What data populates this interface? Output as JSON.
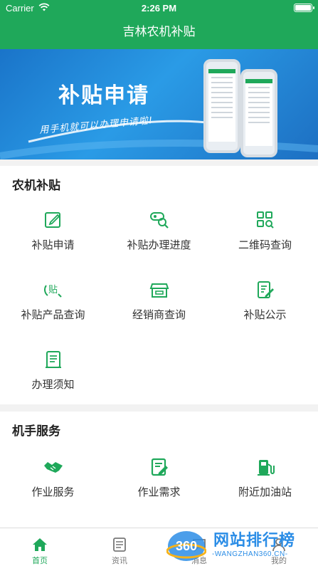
{
  "status_bar": {
    "carrier": "Carrier",
    "time": "2:26 PM"
  },
  "nav": {
    "title": "吉林农机补贴"
  },
  "banner": {
    "title": "补贴申请",
    "slogan": "用手机就可以办理申请啦!"
  },
  "colors": {
    "brand_green": "#1fa85a",
    "banner_blue": "#1f86d6"
  },
  "sections": {
    "subsidy": {
      "title": "农机补贴",
      "items": [
        {
          "label": "补贴申请",
          "icon": "edit-icon"
        },
        {
          "label": "补贴办理进度",
          "icon": "progress-search-icon"
        },
        {
          "label": "二维码查询",
          "icon": "qr-search-icon"
        },
        {
          "label": "补贴产品查询",
          "icon": "subsidy-search-icon"
        },
        {
          "label": "经销商查询",
          "icon": "store-icon"
        },
        {
          "label": "补贴公示",
          "icon": "notice-icon"
        },
        {
          "label": "办理须知",
          "icon": "document-icon"
        }
      ]
    },
    "operator": {
      "title": "机手服务",
      "items": [
        {
          "label": "作业服务",
          "icon": "handshake-icon"
        },
        {
          "label": "作业需求",
          "icon": "request-icon"
        },
        {
          "label": "附近加油站",
          "icon": "fuel-icon"
        }
      ]
    }
  },
  "tabs": [
    {
      "label": "首页",
      "icon": "home-icon",
      "active": true
    },
    {
      "label": "资讯",
      "icon": "news-icon",
      "active": false
    },
    {
      "label": "消息",
      "icon": "message-icon",
      "active": false
    },
    {
      "label": "我的",
      "icon": "user-icon",
      "active": false
    }
  ],
  "watermark": {
    "logo": "360",
    "text": "网站排行榜",
    "url": "-WANGZHAN360.CN-"
  }
}
